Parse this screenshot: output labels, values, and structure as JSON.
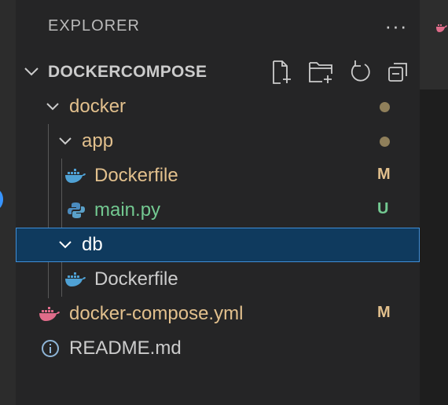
{
  "panel": {
    "title": "EXPLORER",
    "more_label": "···"
  },
  "root": {
    "label": "DOCKERCOMPOSE",
    "actions": [
      "new-file-icon",
      "new-folder-icon",
      "refresh-icon",
      "collapse-all-icon"
    ]
  },
  "tree": [
    {
      "label": "docker",
      "kind": "folder",
      "expanded": true,
      "status": "",
      "dot": true,
      "color": "#e2c08d"
    },
    {
      "label": "app",
      "kind": "folder",
      "expanded": true,
      "status": "",
      "dot": true,
      "color": "#e2c08d"
    },
    {
      "label": "Dockerfile",
      "kind": "docker-file",
      "status": "M",
      "color": "#e2c08d",
      "status_color": "#e2c08d"
    },
    {
      "label": "main.py",
      "kind": "python-file",
      "status": "U",
      "color": "#73c991",
      "status_color": "#73c991"
    },
    {
      "label": "db",
      "kind": "folder",
      "expanded": true,
      "selected": true,
      "color": "#cccccc"
    },
    {
      "label": "Dockerfile",
      "kind": "docker-file",
      "status": "",
      "color": "#cccccc"
    },
    {
      "label": "docker-compose.yml",
      "kind": "compose-file",
      "status": "M",
      "color": "#e2c08d",
      "status_color": "#e2c08d"
    },
    {
      "label": "README.md",
      "kind": "info-file",
      "status": "",
      "color": "#cccccc"
    }
  ],
  "colors": {
    "sidebar_bg": "#252526",
    "selection_bg": "#0f3a5e",
    "selection_border": "#3f8ed8",
    "modified": "#e2c08d",
    "untracked": "#73c991"
  }
}
